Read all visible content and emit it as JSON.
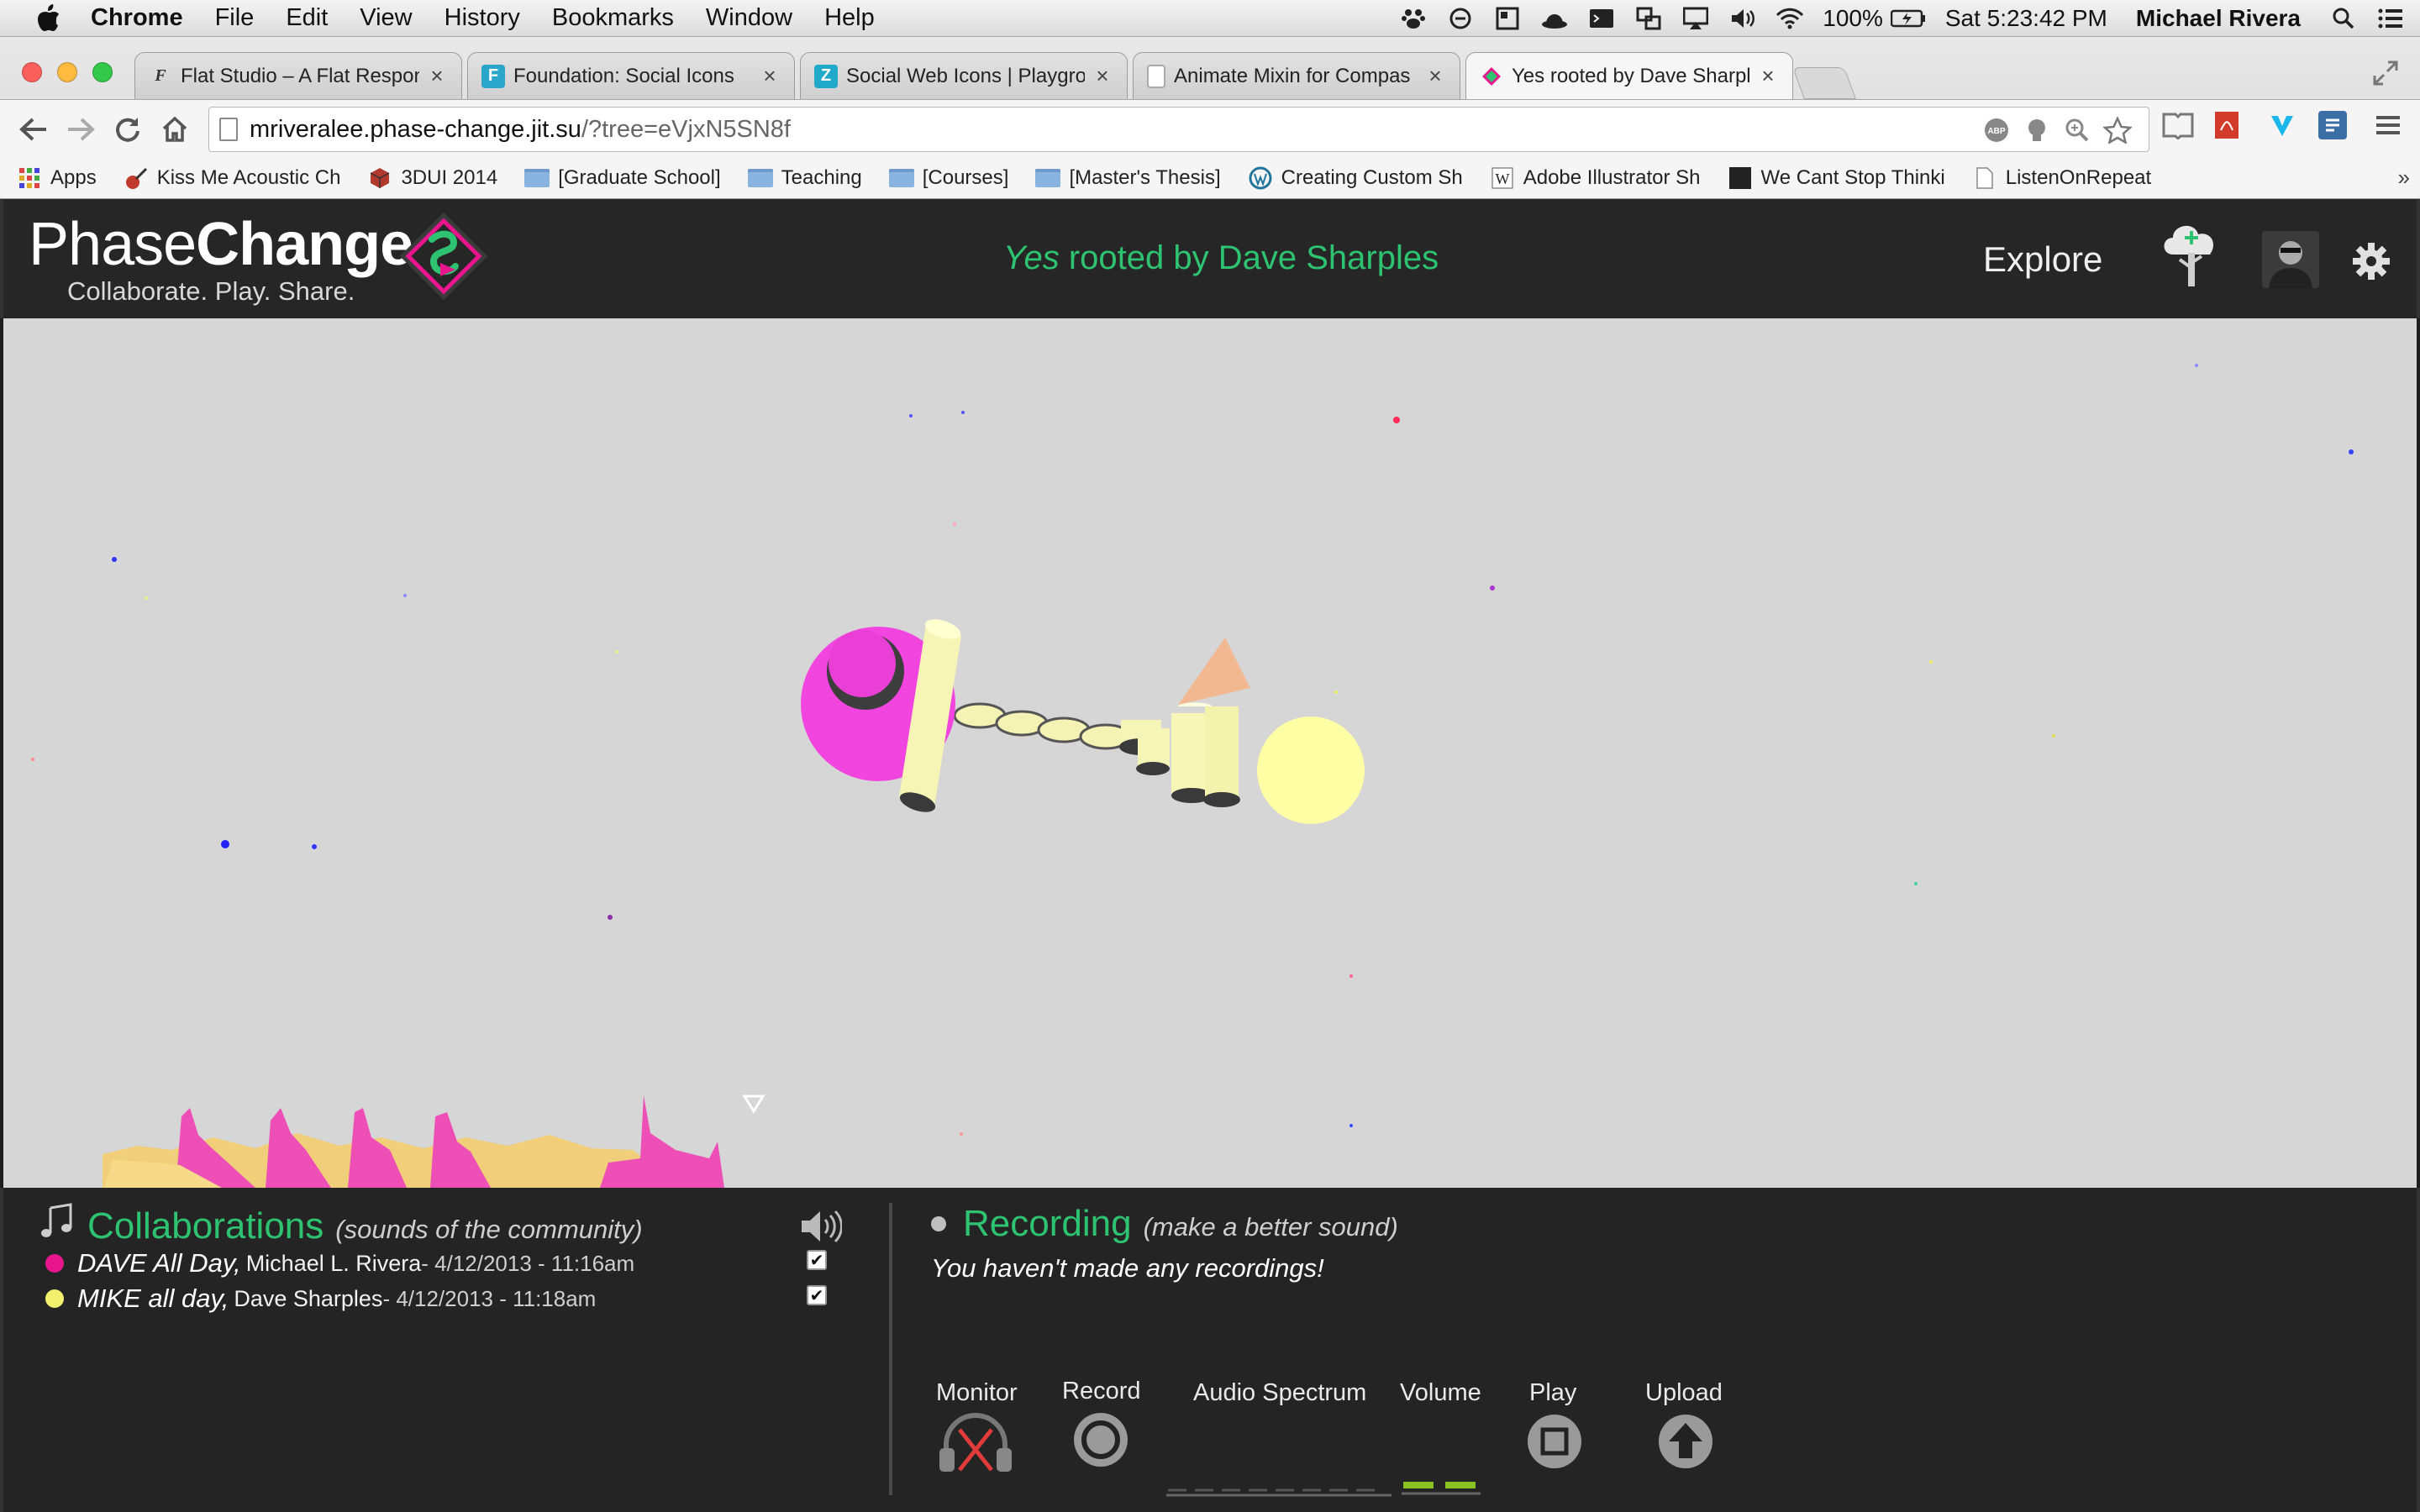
{
  "menubar": {
    "app_name": "Chrome",
    "items": [
      "File",
      "Edit",
      "View",
      "History",
      "Bookmarks",
      "Window",
      "Help"
    ],
    "battery": "100%",
    "clock": "Sat 5:23:42 PM",
    "user": "Michael Rivera"
  },
  "tabs": [
    {
      "title": "Flat Studio – A Flat Respon",
      "favicon": "flat-favicon"
    },
    {
      "title": "Foundation: Social Icons",
      "favicon": "foundation-favicon"
    },
    {
      "title": "Social Web Icons | Playgrou",
      "favicon": "zurb-favicon"
    },
    {
      "title": "Animate Mixin for Compas",
      "favicon": "page-favicon"
    },
    {
      "title": "Yes rooted by Dave Sharple",
      "favicon": "phasechange-favicon"
    }
  ],
  "address": {
    "host": "mriveralee.phase-change.jit.su",
    "path": "/?tree=eVjxN5SN8f"
  },
  "bookmarks": [
    {
      "label": "Apps",
      "icon": "apps-grid-icon"
    },
    {
      "label": "Kiss Me Acoustic Ch",
      "icon": "guitar-icon"
    },
    {
      "label": "3DUI 2014",
      "icon": "cube-icon"
    },
    {
      "label": "[Graduate School]",
      "icon": "folder-icon"
    },
    {
      "label": "Teaching",
      "icon": "folder-icon"
    },
    {
      "label": "[Courses]",
      "icon": "folder-icon"
    },
    {
      "label": "[Master's Thesis]",
      "icon": "folder-icon"
    },
    {
      "label": "Creating Custom Sh",
      "icon": "wordpress-icon"
    },
    {
      "label": "Adobe Illustrator Sh",
      "icon": "w-icon"
    },
    {
      "label": "We Cant Stop Thinki",
      "icon": "black-square-icon"
    },
    {
      "label": "ListenOnRepeat",
      "icon": "page-icon"
    }
  ],
  "header": {
    "logo_light": "Phase",
    "logo_bold": "Change",
    "tagline": "Collaborate. Play. Share.",
    "title_song": "Yes",
    "title_rest": "rooted by Dave Sharples",
    "explore": "Explore"
  },
  "collaborations": {
    "title": "Collaborations",
    "subtitle": "(sounds of the community)",
    "items": [
      {
        "name": "DAVE All Day,",
        "author": "Michael L. Rivera",
        "date": " - 4/12/2013 - 11:16am",
        "color": "#e8168c",
        "checked": true
      },
      {
        "name": "MIKE all day,",
        "author": "Dave Sharples",
        "date": " - 4/12/2013 - 11:18am",
        "color": "#f3f06e",
        "checked": true
      }
    ]
  },
  "recording": {
    "title": "Recording",
    "subtitle": "(make a better sound)",
    "empty_message": "You haven't made any recordings!",
    "controls": {
      "monitor": "Monitor",
      "record": "Record",
      "spectrum": "Audio Spectrum",
      "volume": "Volume",
      "play": "Play",
      "upload": "Upload"
    }
  },
  "colors": {
    "accent": "#2ec371",
    "magenta": "#ef3ce0",
    "yellow": "#f7f7a8",
    "peach": "#f2b892"
  }
}
